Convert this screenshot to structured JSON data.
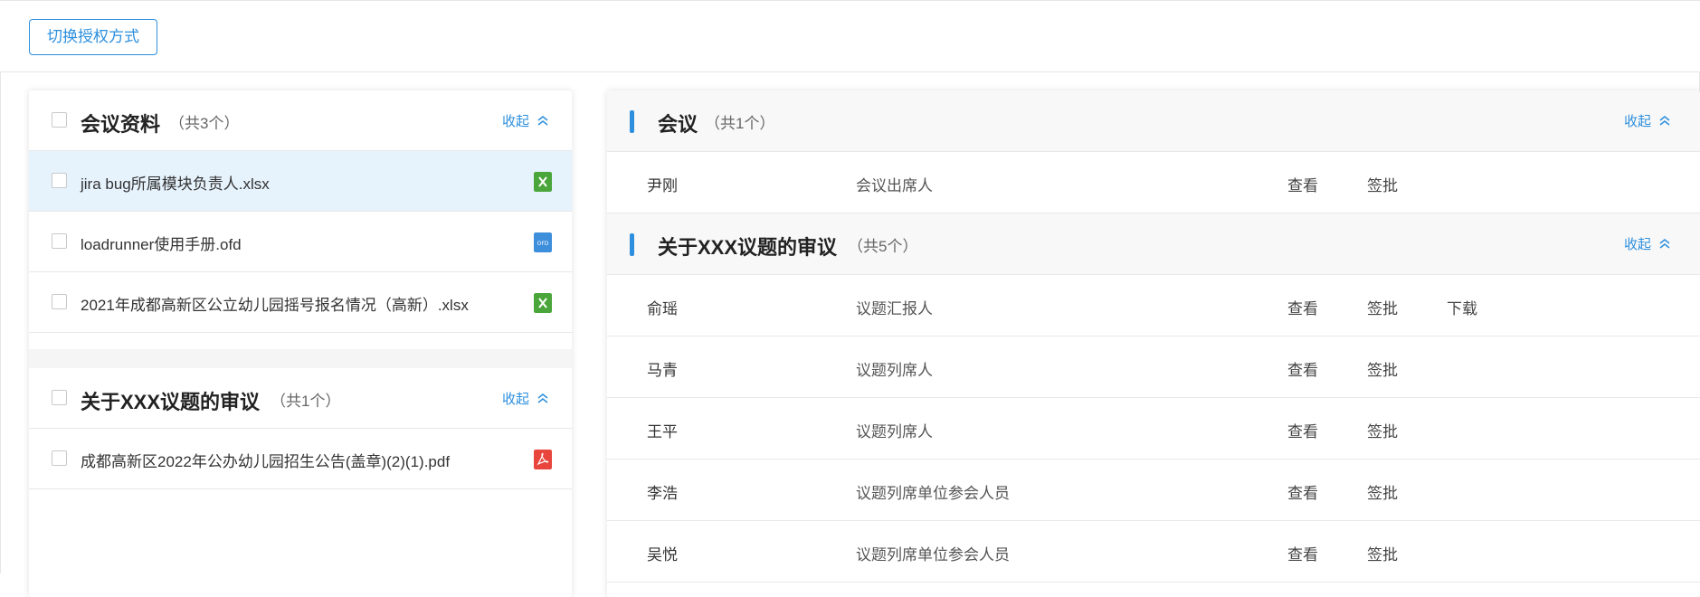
{
  "toolbar": {
    "switch_label": "切换授权方式"
  },
  "left": {
    "sections": [
      {
        "title": "会议资料",
        "count": "（共3个）",
        "collapse": "收起",
        "files": [
          {
            "name": "jira bug所属模块负责人.xlsx",
            "icon": "excel-file-icon",
            "color": "#4aa63a"
          },
          {
            "name": "loadrunner使用手册.ofd",
            "icon": "ofd-file-icon",
            "color": "#3d8edb"
          },
          {
            "name": "2021年成都高新区公立幼儿园摇号报名情况（高新）.xlsx",
            "icon": "excel-file-icon",
            "color": "#4aa63a"
          }
        ]
      },
      {
        "title": "关于XXX议题的审议",
        "count": "（共1个）",
        "collapse": "收起",
        "files": [
          {
            "name": "成都高新区2022年公办幼儿园招生公告(盖章)(2)(1).pdf",
            "icon": "pdf-file-icon",
            "color": "#e8453c"
          }
        ]
      }
    ]
  },
  "right": {
    "sections": [
      {
        "title": "会议",
        "count": "（共1个）",
        "collapse": "收起",
        "rows": [
          {
            "name": "尹刚",
            "role": "会议出席人",
            "view": "查看",
            "approve": "签批",
            "download": ""
          }
        ]
      },
      {
        "title": "关于XXX议题的审议",
        "count": "（共5个）",
        "collapse": "收起",
        "rows": [
          {
            "name": "俞瑶",
            "role": "议题汇报人",
            "view": "查看",
            "approve": "签批",
            "download": "下载"
          },
          {
            "name": "马青",
            "role": "议题列席人",
            "view": "查看",
            "approve": "签批",
            "download": ""
          },
          {
            "name": "王平",
            "role": "议题列席人",
            "view": "查看",
            "approve": "签批",
            "download": ""
          },
          {
            "name": "李浩",
            "role": "议题列席单位参会人员",
            "view": "查看",
            "approve": "签批",
            "download": ""
          },
          {
            "name": "吴悦",
            "role": "议题列席单位参会人员",
            "view": "查看",
            "approve": "签批",
            "download": ""
          }
        ]
      }
    ]
  },
  "colors": {
    "accent": "#2d8fdd",
    "selected_row": "#e6f2fc"
  }
}
